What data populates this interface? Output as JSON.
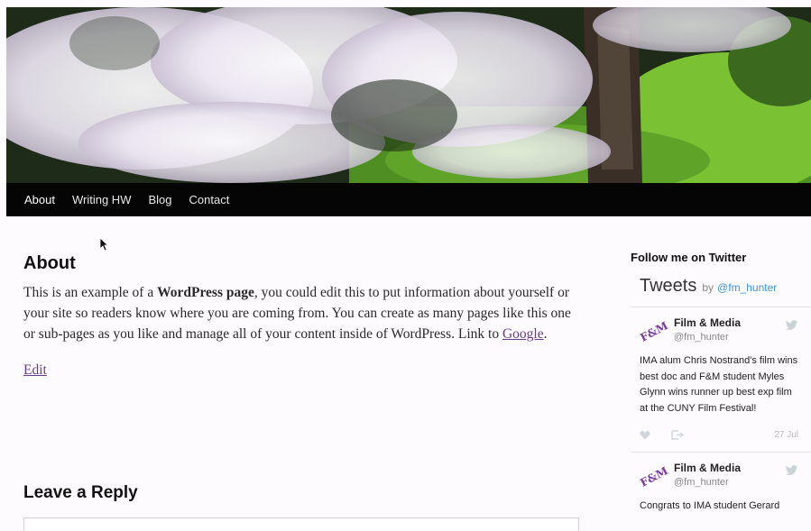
{
  "nav": {
    "items": [
      "About",
      "Writing HW",
      "Blog",
      "Contact"
    ]
  },
  "page": {
    "title": "About",
    "body_pre": "This is an example of a ",
    "body_strong": "WordPress page",
    "body_mid": ", you could edit this to put information about yourself or your site so readers know where you are coming from. You can create as many pages like this one or sub-pages as you like and manage all of your content inside of WordPress. Link to ",
    "body_link": "Google",
    "body_post": ".",
    "edit_label": "Edit"
  },
  "reply": {
    "title": "Leave a Reply"
  },
  "sidebar": {
    "widget_title": "Follow me on Twitter",
    "tweets_label": "Tweets",
    "by_label": "by",
    "handle": "@fm_hunter",
    "tweets": [
      {
        "avatar": "F&M",
        "name": "Film & Media",
        "username": "@fm_hunter",
        "text": "IMA alum Chris Nostrand's film wins best doc and F&M student Myles Glynn wins runner up best exp film at the CUNY Film Festival!",
        "date": "27 Jul"
      },
      {
        "avatar": "F&M",
        "name": "Film & Media",
        "username": "@fm_hunter",
        "text": "Congrats to IMA student Gerard",
        "date": ""
      }
    ]
  },
  "colors": {
    "link": "#6b3a8c",
    "twitter_blue": "#3b94d9",
    "nav_bg": "#050505"
  }
}
